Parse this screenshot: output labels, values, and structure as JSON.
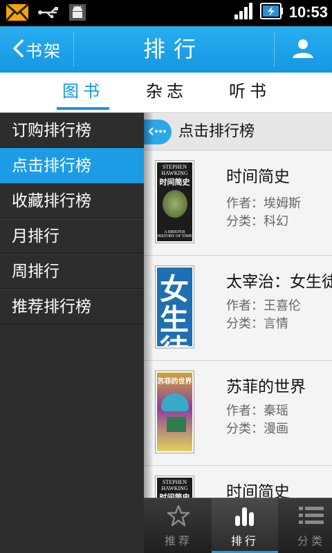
{
  "status_bar": {
    "time": "10:53"
  },
  "header": {
    "back_label": "书架",
    "title": "排行"
  },
  "tabs": [
    {
      "label": "图书",
      "active": true
    },
    {
      "label": "杂志",
      "active": false
    },
    {
      "label": "听书",
      "active": false
    }
  ],
  "side_menu": [
    {
      "label": "订购排行榜",
      "active": false
    },
    {
      "label": "点击排行榜",
      "active": true
    },
    {
      "label": "收藏排行榜",
      "active": false
    },
    {
      "label": "月排行",
      "active": false
    },
    {
      "label": "周排行",
      "active": false
    },
    {
      "label": "推荐排行榜",
      "active": false
    }
  ],
  "content": {
    "section_title": "点击排行榜",
    "books": [
      {
        "title": "时间简史",
        "author": "作者：埃姆斯",
        "category": "分类：科幻",
        "cover": {
          "top": "STEPHEN HAWKING",
          "big": "时间简史",
          "foot": "A BRIEFER HISTORY OF TIME"
        }
      },
      {
        "title": "太宰治：女生徒",
        "author": "作者：王喜伦",
        "category": "分类：言情",
        "cover": {
          "big": "女生徒"
        }
      },
      {
        "title": "苏菲的世界",
        "author": "作者：秦瑶",
        "category": "分类：漫画",
        "cover": {
          "big": "苏菲的世界"
        }
      },
      {
        "title": "时间简史",
        "author": "",
        "category": "",
        "cover": {
          "top": "STEPHEN HAWKING",
          "big": "时间简史",
          "foot": ""
        }
      }
    ]
  },
  "bottom_nav": [
    {
      "label": "推荐",
      "icon": "star-icon",
      "active": false
    },
    {
      "label": "排行",
      "icon": "bar-chart-icon",
      "active": true
    },
    {
      "label": "分类",
      "icon": "list-icon",
      "active": false
    }
  ],
  "colors": {
    "accent": "#1596e2",
    "menu_bg": "#2d2d2d",
    "content_bg": "#f4f4f4"
  }
}
